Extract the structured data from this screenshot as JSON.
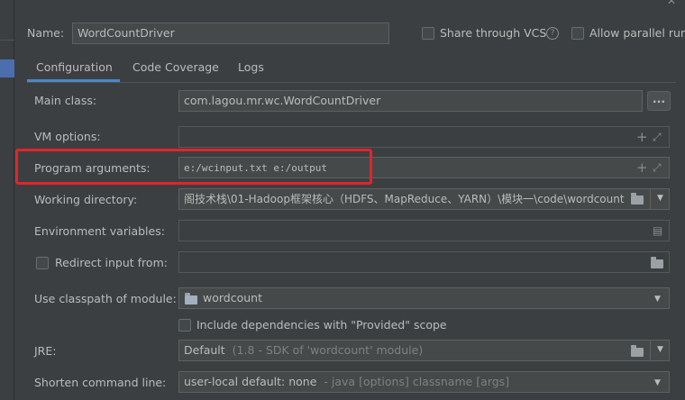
{
  "header": {
    "name_label": "Name:",
    "name_value": "WordCountDriver",
    "share_vcs_label": "Share through VCS",
    "parallel_run_label": "Allow parallel run"
  },
  "tabs": [
    {
      "label": "Configuration",
      "active": true
    },
    {
      "label": "Code Coverage",
      "active": false
    },
    {
      "label": "Logs",
      "active": false
    }
  ],
  "form": {
    "main_class_label": "Main class:",
    "main_class_value": "com.lagou.mr.wc.WordCountDriver",
    "browse_button": "...",
    "vm_options_label": "VM options:",
    "vm_options_value": "",
    "program_args_label": "Program arguments:",
    "program_args_value": "e:/wcinput.txt e:/output",
    "working_dir_label": "Working directory:",
    "working_dir_value": "阁技术栈\\01-Hadoop框架核心（HDFS、MapReduce、YARN）\\模块一\\code\\wordcount",
    "env_vars_label": "Environment variables:",
    "env_vars_value": "",
    "redirect_input_label": "Redirect input from:",
    "redirect_input_value": "",
    "classpath_label": "Use classpath of module:",
    "classpath_value": "wordcount",
    "include_deps_label": "Include dependencies with \"Provided\" scope",
    "jre_label": "JRE:",
    "jre_value": "Default",
    "jre_hint": "(1.8 - SDK of 'wordcount' module)",
    "shorten_label": "Shorten command line:",
    "shorten_value": "user-local default: none",
    "shorten_hint": "- java [options] classname [args]"
  },
  "colors": {
    "background": "#3c3f41",
    "field": "#45494a",
    "highlight_box": "#e3242b",
    "active_tab": "#4a88c7"
  }
}
